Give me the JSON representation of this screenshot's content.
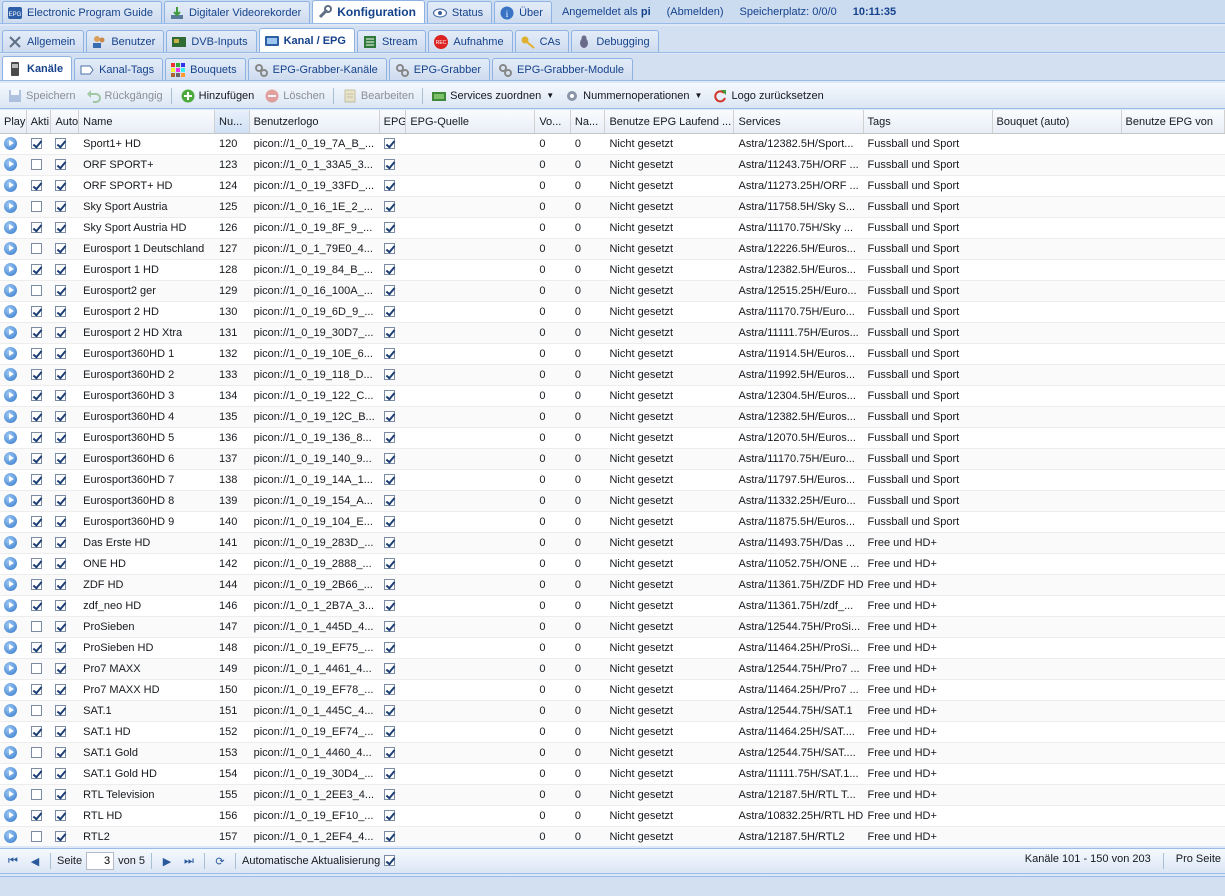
{
  "top_tabs": [
    {
      "label": "Electronic Program Guide",
      "icon": "epg-icon"
    },
    {
      "label": "Digitaler Videorekorder",
      "icon": "download-icon"
    },
    {
      "label": "Konfiguration",
      "icon": "wrench-icon",
      "active": true
    },
    {
      "label": "Status",
      "icon": "eye-icon"
    },
    {
      "label": "Über",
      "icon": "info-icon"
    }
  ],
  "session": {
    "logged_in_prefix": "Angemeldet als",
    "user": "pi",
    "logout": "(Abmelden)",
    "storage": "Speicherplatz: 0/0/0",
    "time": "10:11:35"
  },
  "config_tabs": [
    {
      "label": "Allgemein"
    },
    {
      "label": "Benutzer"
    },
    {
      "label": "DVB-Inputs"
    },
    {
      "label": "Kanal / EPG",
      "active": true
    },
    {
      "label": "Stream"
    },
    {
      "label": "Aufnahme"
    },
    {
      "label": "CAs"
    },
    {
      "label": "Debugging"
    }
  ],
  "channel_tabs": [
    {
      "label": "Kanäle",
      "active": true
    },
    {
      "label": "Kanal-Tags"
    },
    {
      "label": "Bouquets"
    },
    {
      "label": "EPG-Grabber-Kanäle"
    },
    {
      "label": "EPG-Grabber"
    },
    {
      "label": "EPG-Grabber-Module"
    }
  ],
  "toolbar": {
    "save": "Speichern",
    "undo": "Rückgängig",
    "add": "Hinzufügen",
    "delete": "Löschen",
    "edit": "Bearbeiten",
    "map_services": "Services zuordnen",
    "number_ops": "Nummernoperationen",
    "reset_logo": "Logo zurücksetzen"
  },
  "columns": [
    "Play",
    "Akti",
    "Auto",
    "Name",
    "Nu...",
    "Benutzerlogo",
    "EPG",
    "EPG-Quelle",
    "Vo...",
    "Na...",
    "Benutze EPG Laufend ...",
    "Services",
    "Tags",
    "Bouquet (auto)",
    "Benutze EPG von"
  ],
  "rows": [
    {
      "akt": true,
      "aut": true,
      "name": "Sport1+ HD",
      "nr": "120",
      "logo": "picon://1_0_19_7A_B_...",
      "epg": true,
      "vo": "0",
      "na": "0",
      "lauf": "Nicht gesetzt",
      "svc": "Astra/12382.5H/Sport...",
      "tags": "Fussball und Sport"
    },
    {
      "akt": false,
      "aut": true,
      "name": "ORF SPORT+",
      "nr": "123",
      "logo": "picon://1_0_1_33A5_3...",
      "epg": true,
      "vo": "0",
      "na": "0",
      "lauf": "Nicht gesetzt",
      "svc": "Astra/11243.75H/ORF ...",
      "tags": "Fussball und Sport"
    },
    {
      "akt": true,
      "aut": true,
      "name": "ORF SPORT+ HD",
      "nr": "124",
      "logo": "picon://1_0_19_33FD_...",
      "epg": true,
      "vo": "0",
      "na": "0",
      "lauf": "Nicht gesetzt",
      "svc": "Astra/11273.25H/ORF ...",
      "tags": "Fussball und Sport"
    },
    {
      "akt": false,
      "aut": true,
      "name": "Sky Sport Austria",
      "nr": "125",
      "logo": "picon://1_0_16_1E_2_...",
      "epg": true,
      "vo": "0",
      "na": "0",
      "lauf": "Nicht gesetzt",
      "svc": "Astra/11758.5H/Sky S...",
      "tags": "Fussball und Sport"
    },
    {
      "akt": true,
      "aut": true,
      "name": "Sky Sport Austria HD",
      "nr": "126",
      "logo": "picon://1_0_19_8F_9_...",
      "epg": true,
      "vo": "0",
      "na": "0",
      "lauf": "Nicht gesetzt",
      "svc": "Astra/11170.75H/Sky ...",
      "tags": "Fussball und Sport"
    },
    {
      "akt": false,
      "aut": true,
      "name": "Eurosport 1 Deutschland",
      "nr": "127",
      "logo": "picon://1_0_1_79E0_4...",
      "epg": true,
      "vo": "0",
      "na": "0",
      "lauf": "Nicht gesetzt",
      "svc": "Astra/12226.5H/Euros...",
      "tags": "Fussball und Sport"
    },
    {
      "akt": true,
      "aut": true,
      "name": "Eurosport 1 HD",
      "nr": "128",
      "logo": "picon://1_0_19_84_B_...",
      "epg": true,
      "vo": "0",
      "na": "0",
      "lauf": "Nicht gesetzt",
      "svc": "Astra/12382.5H/Euros...",
      "tags": "Fussball und Sport"
    },
    {
      "akt": false,
      "aut": true,
      "name": "Eurosport2 ger",
      "nr": "129",
      "logo": "picon://1_0_16_100A_...",
      "epg": true,
      "vo": "0",
      "na": "0",
      "lauf": "Nicht gesetzt",
      "svc": "Astra/12515.25H/Euro...",
      "tags": "Fussball und Sport"
    },
    {
      "akt": true,
      "aut": true,
      "name": "Eurosport 2 HD",
      "nr": "130",
      "logo": "picon://1_0_19_6D_9_...",
      "epg": true,
      "vo": "0",
      "na": "0",
      "lauf": "Nicht gesetzt",
      "svc": "Astra/11170.75H/Euro...",
      "tags": "Fussball und Sport"
    },
    {
      "akt": true,
      "aut": true,
      "name": "Eurosport 2 HD Xtra",
      "nr": "131",
      "logo": "picon://1_0_19_30D7_...",
      "epg": true,
      "vo": "0",
      "na": "0",
      "lauf": "Nicht gesetzt",
      "svc": "Astra/11111.75H/Euros...",
      "tags": "Fussball und Sport"
    },
    {
      "akt": true,
      "aut": true,
      "name": "Eurosport360HD 1",
      "nr": "132",
      "logo": "picon://1_0_19_10E_6...",
      "epg": true,
      "vo": "0",
      "na": "0",
      "lauf": "Nicht gesetzt",
      "svc": "Astra/11914.5H/Euros...",
      "tags": "Fussball und Sport"
    },
    {
      "akt": true,
      "aut": true,
      "name": "Eurosport360HD 2",
      "nr": "133",
      "logo": "picon://1_0_19_118_D...",
      "epg": true,
      "vo": "0",
      "na": "0",
      "lauf": "Nicht gesetzt",
      "svc": "Astra/11992.5H/Euros...",
      "tags": "Fussball und Sport"
    },
    {
      "akt": true,
      "aut": true,
      "name": "Eurosport360HD 3",
      "nr": "134",
      "logo": "picon://1_0_19_122_C...",
      "epg": true,
      "vo": "0",
      "na": "0",
      "lauf": "Nicht gesetzt",
      "svc": "Astra/12304.5H/Euros...",
      "tags": "Fussball und Sport"
    },
    {
      "akt": true,
      "aut": true,
      "name": "Eurosport360HD 4",
      "nr": "135",
      "logo": "picon://1_0_19_12C_B...",
      "epg": true,
      "vo": "0",
      "na": "0",
      "lauf": "Nicht gesetzt",
      "svc": "Astra/12382.5H/Euros...",
      "tags": "Fussball und Sport"
    },
    {
      "akt": true,
      "aut": true,
      "name": "Eurosport360HD 5",
      "nr": "136",
      "logo": "picon://1_0_19_136_8...",
      "epg": true,
      "vo": "0",
      "na": "0",
      "lauf": "Nicht gesetzt",
      "svc": "Astra/12070.5H/Euros...",
      "tags": "Fussball und Sport"
    },
    {
      "akt": true,
      "aut": true,
      "name": "Eurosport360HD 6",
      "nr": "137",
      "logo": "picon://1_0_19_140_9...",
      "epg": true,
      "vo": "0",
      "na": "0",
      "lauf": "Nicht gesetzt",
      "svc": "Astra/11170.75H/Euro...",
      "tags": "Fussball und Sport"
    },
    {
      "akt": true,
      "aut": true,
      "name": "Eurosport360HD 7",
      "nr": "138",
      "logo": "picon://1_0_19_14A_1...",
      "epg": true,
      "vo": "0",
      "na": "0",
      "lauf": "Nicht gesetzt",
      "svc": "Astra/11797.5H/Euros...",
      "tags": "Fussball und Sport"
    },
    {
      "akt": true,
      "aut": true,
      "name": "Eurosport360HD 8",
      "nr": "139",
      "logo": "picon://1_0_19_154_A...",
      "epg": true,
      "vo": "0",
      "na": "0",
      "lauf": "Nicht gesetzt",
      "svc": "Astra/11332.25H/Euro...",
      "tags": "Fussball und Sport"
    },
    {
      "akt": true,
      "aut": true,
      "name": "Eurosport360HD 9",
      "nr": "140",
      "logo": "picon://1_0_19_104_E...",
      "epg": true,
      "vo": "0",
      "na": "0",
      "lauf": "Nicht gesetzt",
      "svc": "Astra/11875.5H/Euros...",
      "tags": "Fussball und Sport"
    },
    {
      "akt": true,
      "aut": true,
      "name": "Das Erste HD",
      "nr": "141",
      "logo": "picon://1_0_19_283D_...",
      "epg": true,
      "vo": "0",
      "na": "0",
      "lauf": "Nicht gesetzt",
      "svc": "Astra/11493.75H/Das ...",
      "tags": "Free und HD+"
    },
    {
      "akt": true,
      "aut": true,
      "name": "ONE HD",
      "nr": "142",
      "logo": "picon://1_0_19_2888_...",
      "epg": true,
      "vo": "0",
      "na": "0",
      "lauf": "Nicht gesetzt",
      "svc": "Astra/11052.75H/ONE ...",
      "tags": "Free und HD+"
    },
    {
      "akt": true,
      "aut": true,
      "name": "ZDF HD",
      "nr": "144",
      "logo": "picon://1_0_19_2B66_...",
      "epg": true,
      "vo": "0",
      "na": "0",
      "lauf": "Nicht gesetzt",
      "svc": "Astra/11361.75H/ZDF HD",
      "tags": "Free und HD+"
    },
    {
      "akt": true,
      "aut": true,
      "name": "zdf_neo HD",
      "nr": "146",
      "logo": "picon://1_0_1_2B7A_3...",
      "epg": true,
      "vo": "0",
      "na": "0",
      "lauf": "Nicht gesetzt",
      "svc": "Astra/11361.75H/zdf_...",
      "tags": "Free und HD+"
    },
    {
      "akt": false,
      "aut": true,
      "name": "ProSieben",
      "nr": "147",
      "logo": "picon://1_0_1_445D_4...",
      "epg": true,
      "vo": "0",
      "na": "0",
      "lauf": "Nicht gesetzt",
      "svc": "Astra/12544.75H/ProSi...",
      "tags": "Free und HD+"
    },
    {
      "akt": true,
      "aut": true,
      "name": "ProSieben HD",
      "nr": "148",
      "logo": "picon://1_0_19_EF75_...",
      "epg": true,
      "vo": "0",
      "na": "0",
      "lauf": "Nicht gesetzt",
      "svc": "Astra/11464.25H/ProSi...",
      "tags": "Free und HD+"
    },
    {
      "akt": false,
      "aut": true,
      "name": "Pro7 MAXX",
      "nr": "149",
      "logo": "picon://1_0_1_4461_4...",
      "epg": true,
      "vo": "0",
      "na": "0",
      "lauf": "Nicht gesetzt",
      "svc": "Astra/12544.75H/Pro7 ...",
      "tags": "Free und HD+"
    },
    {
      "akt": true,
      "aut": true,
      "name": "Pro7 MAXX HD",
      "nr": "150",
      "logo": "picon://1_0_19_EF78_...",
      "epg": true,
      "vo": "0",
      "na": "0",
      "lauf": "Nicht gesetzt",
      "svc": "Astra/11464.25H/Pro7 ...",
      "tags": "Free und HD+"
    },
    {
      "akt": false,
      "aut": true,
      "name": "SAT.1",
      "nr": "151",
      "logo": "picon://1_0_1_445C_4...",
      "epg": true,
      "vo": "0",
      "na": "0",
      "lauf": "Nicht gesetzt",
      "svc": "Astra/12544.75H/SAT.1",
      "tags": "Free und HD+"
    },
    {
      "akt": true,
      "aut": true,
      "name": "SAT.1 HD",
      "nr": "152",
      "logo": "picon://1_0_19_EF74_...",
      "epg": true,
      "vo": "0",
      "na": "0",
      "lauf": "Nicht gesetzt",
      "svc": "Astra/11464.25H/SAT....",
      "tags": "Free und HD+"
    },
    {
      "akt": false,
      "aut": true,
      "name": "SAT.1 Gold",
      "nr": "153",
      "logo": "picon://1_0_1_4460_4...",
      "epg": true,
      "vo": "0",
      "na": "0",
      "lauf": "Nicht gesetzt",
      "svc": "Astra/12544.75H/SAT....",
      "tags": "Free und HD+"
    },
    {
      "akt": true,
      "aut": true,
      "name": "SAT.1 Gold HD",
      "nr": "154",
      "logo": "picon://1_0_19_30D4_...",
      "epg": true,
      "vo": "0",
      "na": "0",
      "lauf": "Nicht gesetzt",
      "svc": "Astra/11111.75H/SAT.1...",
      "tags": "Free und HD+"
    },
    {
      "akt": false,
      "aut": true,
      "name": "RTL Television",
      "nr": "155",
      "logo": "picon://1_0_1_2EE3_4...",
      "epg": true,
      "vo": "0",
      "na": "0",
      "lauf": "Nicht gesetzt",
      "svc": "Astra/12187.5H/RTL T...",
      "tags": "Free und HD+"
    },
    {
      "akt": true,
      "aut": true,
      "name": "RTL HD",
      "nr": "156",
      "logo": "picon://1_0_19_EF10_...",
      "epg": true,
      "vo": "0",
      "na": "0",
      "lauf": "Nicht gesetzt",
      "svc": "Astra/10832.25H/RTL HD",
      "tags": "Free und HD+"
    },
    {
      "akt": false,
      "aut": true,
      "name": "RTL2",
      "nr": "157",
      "logo": "picon://1_0_1_2EF4_4...",
      "epg": true,
      "vo": "0",
      "na": "0",
      "lauf": "Nicht gesetzt",
      "svc": "Astra/12187.5H/RTL2",
      "tags": "Free und HD+"
    }
  ],
  "pager": {
    "page_label": "Seite",
    "page_value": "3",
    "of_label": "von 5",
    "auto_refresh": "Automatische Aktualisierung",
    "auto_refresh_checked": true,
    "summary": "Kanäle 101 - 150 von 203",
    "per_page": "Pro Seite"
  }
}
